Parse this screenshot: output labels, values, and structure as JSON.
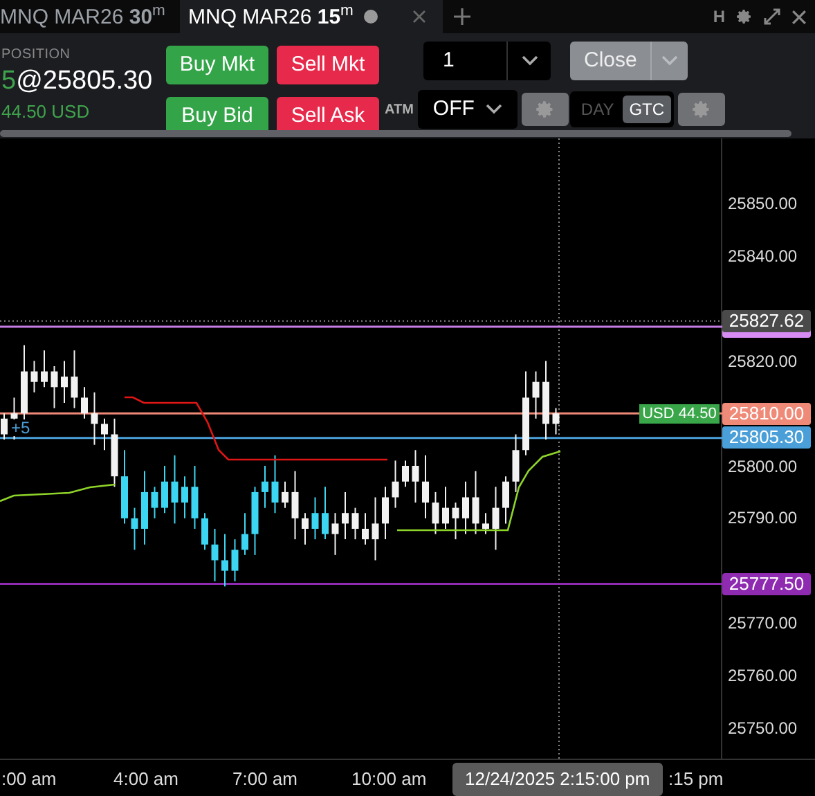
{
  "tabs": [
    {
      "label": "MNQ MAR26 **30**$^{m}$",
      "selected": false
    },
    {
      "label": "MNQ MAR26 **15**$^{m}$",
      "selected": true
    }
  ],
  "window_buttons": [
    "H"
  ],
  "position": {
    "title": "POSITION",
    "quantity": "5",
    "price": "@25805.30",
    "pnl": "44.50 USD"
  },
  "order_buttons": [
    {
      "label": "Buy Mkt",
      "kind": "buy"
    },
    {
      "label": "Sell Mkt",
      "kind": "sell"
    },
    {
      "label": "Buy Bid",
      "kind": "buy"
    },
    {
      "label": "Sell Ask",
      "kind": "sell"
    }
  ],
  "quantity_field": {
    "value": "1"
  },
  "close_button": {
    "label": "Close"
  },
  "atm": {
    "label": "ATM",
    "value": "OFF"
  },
  "time_in_force": [
    {
      "label": "DAY",
      "selected": false
    },
    {
      "label": "GTC",
      "selected": true
    }
  ],
  "chart": {
    "price_ticks": [
      "25850.00",
      "25840.00",
      "25820.00",
      "25800.00",
      "25790.00",
      "25770.00",
      "25760.00",
      "25750.00"
    ],
    "price_markers": [
      {
        "label": "25827.62",
        "color": "#4a4a4a",
        "kind": "crosshair"
      },
      {
        "label": "25810.00",
        "color": "#f08a78",
        "kind": "level"
      },
      {
        "label": "25805.30",
        "color": "#4a9fd8",
        "kind": "level"
      },
      {
        "label": "25777.50",
        "color": "#8e2bb0",
        "kind": "level"
      }
    ],
    "pnl_tag": "USD 44.50",
    "position_tag": "+5",
    "time_labels": [
      ":00 am",
      "4:00 am",
      "7:00 am",
      "10:00 am"
    ],
    "crosshair_time": "12/24/2025 2:15:00 pm",
    "last_time_label": ":15 pm"
  }
}
